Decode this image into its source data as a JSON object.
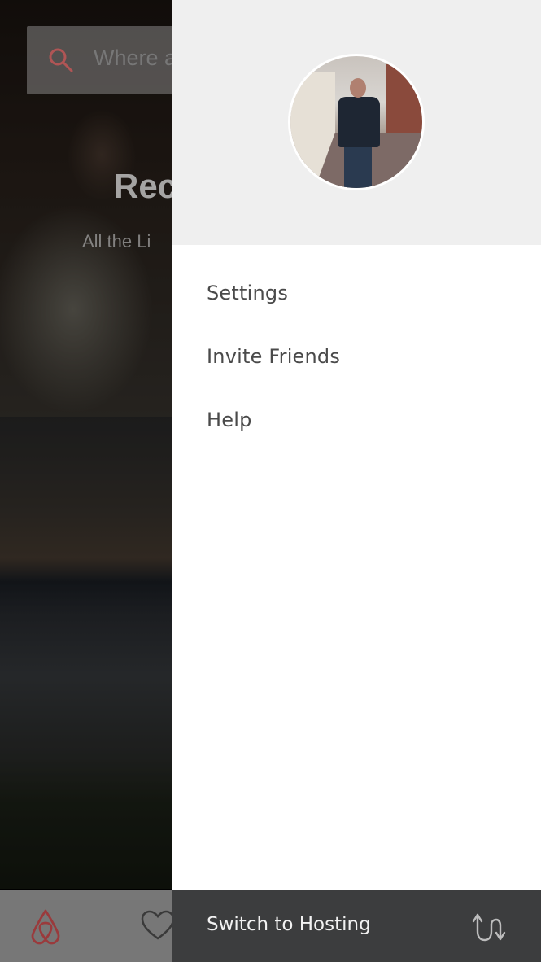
{
  "background": {
    "search": {
      "placeholder": "Where a"
    },
    "hero": {
      "title": "Rec",
      "subtitle": "All the Li"
    },
    "tabbar": {
      "icons": [
        "airbnb-logo-icon",
        "heart-icon"
      ]
    }
  },
  "drawer": {
    "avatar": {
      "alt": "Profile photo"
    },
    "menu": [
      {
        "label": "Settings"
      },
      {
        "label": "Invite Friends"
      },
      {
        "label": "Help"
      }
    ],
    "footer": {
      "label": "Switch to Hosting",
      "icon": "switch-arrows-icon"
    }
  },
  "colors": {
    "accent": "#ff5a5f",
    "drawer_bg": "#ffffff",
    "header_bg": "#efefef",
    "footer_bg": "#3c3d3e"
  }
}
